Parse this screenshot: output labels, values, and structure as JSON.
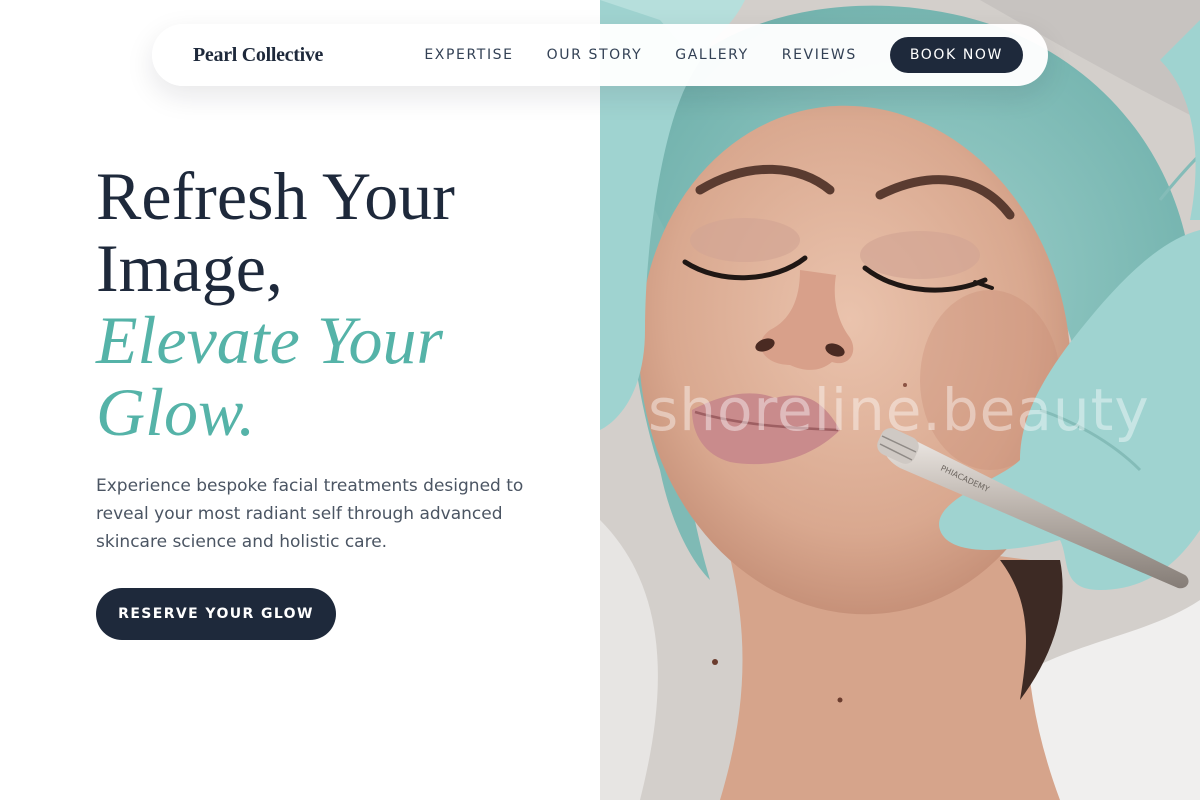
{
  "nav": {
    "brand": "Pearl Collective",
    "links": [
      "EXPERTISE",
      "OUR STORY",
      "GALLERY",
      "REVIEWS"
    ],
    "cta_label": "BOOK NOW"
  },
  "hero": {
    "headline_line1": "Refresh Your",
    "headline_line2": "Image,",
    "accent_line1": "Elevate Your",
    "accent_line2": "Glow.",
    "description": "Experience bespoke facial treatments designed to reveal your most radiant self through advanced skincare science and holistic care.",
    "cta_label": "RESERVE YOUR GLOW"
  },
  "photo": {
    "watermark": "shoreline.beauty",
    "tool_engraving": "PHIACADEMY"
  },
  "colors": {
    "navy": "#1e293b",
    "teal_accent": "#55b3a8",
    "body_text": "#4b5563",
    "scrub_cap": "#8cc5c1",
    "glove": "#9fd3d0"
  }
}
